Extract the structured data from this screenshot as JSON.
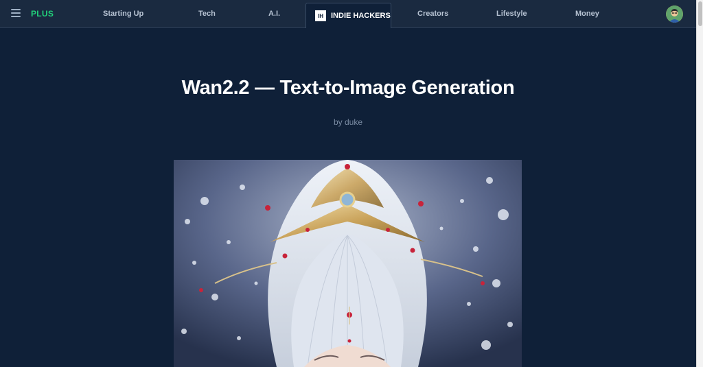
{
  "nav": {
    "plus_label": "PLUS",
    "items": [
      "Starting Up",
      "Tech",
      "A.I.",
      "Creators",
      "Lifestyle",
      "Money"
    ],
    "active": {
      "logo_text": "IH",
      "label": "INDIE HACKERS"
    }
  },
  "article": {
    "title": "Wan2.2 — Text-to-Image Generation",
    "byline": "by duke"
  },
  "colors": {
    "plus": "#21d07a",
    "background": "#0f2038",
    "nav_bg": "#1a2a40"
  }
}
